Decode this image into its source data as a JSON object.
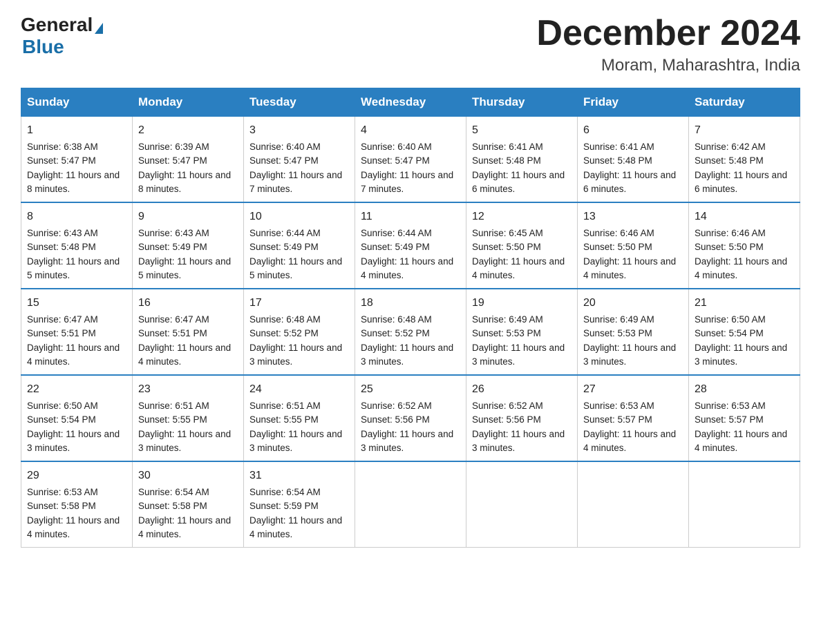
{
  "header": {
    "month_title": "December 2024",
    "location": "Moram, Maharashtra, India",
    "logo_general": "General",
    "logo_blue": "Blue"
  },
  "weekdays": [
    "Sunday",
    "Monday",
    "Tuesday",
    "Wednesday",
    "Thursday",
    "Friday",
    "Saturday"
  ],
  "weeks": [
    [
      {
        "day": "1",
        "sunrise": "6:38 AM",
        "sunset": "5:47 PM",
        "daylight": "11 hours and 8 minutes."
      },
      {
        "day": "2",
        "sunrise": "6:39 AM",
        "sunset": "5:47 PM",
        "daylight": "11 hours and 8 minutes."
      },
      {
        "day": "3",
        "sunrise": "6:40 AM",
        "sunset": "5:47 PM",
        "daylight": "11 hours and 7 minutes."
      },
      {
        "day": "4",
        "sunrise": "6:40 AM",
        "sunset": "5:47 PM",
        "daylight": "11 hours and 7 minutes."
      },
      {
        "day": "5",
        "sunrise": "6:41 AM",
        "sunset": "5:48 PM",
        "daylight": "11 hours and 6 minutes."
      },
      {
        "day": "6",
        "sunrise": "6:41 AM",
        "sunset": "5:48 PM",
        "daylight": "11 hours and 6 minutes."
      },
      {
        "day": "7",
        "sunrise": "6:42 AM",
        "sunset": "5:48 PM",
        "daylight": "11 hours and 6 minutes."
      }
    ],
    [
      {
        "day": "8",
        "sunrise": "6:43 AM",
        "sunset": "5:48 PM",
        "daylight": "11 hours and 5 minutes."
      },
      {
        "day": "9",
        "sunrise": "6:43 AM",
        "sunset": "5:49 PM",
        "daylight": "11 hours and 5 minutes."
      },
      {
        "day": "10",
        "sunrise": "6:44 AM",
        "sunset": "5:49 PM",
        "daylight": "11 hours and 5 minutes."
      },
      {
        "day": "11",
        "sunrise": "6:44 AM",
        "sunset": "5:49 PM",
        "daylight": "11 hours and 4 minutes."
      },
      {
        "day": "12",
        "sunrise": "6:45 AM",
        "sunset": "5:50 PM",
        "daylight": "11 hours and 4 minutes."
      },
      {
        "day": "13",
        "sunrise": "6:46 AM",
        "sunset": "5:50 PM",
        "daylight": "11 hours and 4 minutes."
      },
      {
        "day": "14",
        "sunrise": "6:46 AM",
        "sunset": "5:50 PM",
        "daylight": "11 hours and 4 minutes."
      }
    ],
    [
      {
        "day": "15",
        "sunrise": "6:47 AM",
        "sunset": "5:51 PM",
        "daylight": "11 hours and 4 minutes."
      },
      {
        "day": "16",
        "sunrise": "6:47 AM",
        "sunset": "5:51 PM",
        "daylight": "11 hours and 4 minutes."
      },
      {
        "day": "17",
        "sunrise": "6:48 AM",
        "sunset": "5:52 PM",
        "daylight": "11 hours and 3 minutes."
      },
      {
        "day": "18",
        "sunrise": "6:48 AM",
        "sunset": "5:52 PM",
        "daylight": "11 hours and 3 minutes."
      },
      {
        "day": "19",
        "sunrise": "6:49 AM",
        "sunset": "5:53 PM",
        "daylight": "11 hours and 3 minutes."
      },
      {
        "day": "20",
        "sunrise": "6:49 AM",
        "sunset": "5:53 PM",
        "daylight": "11 hours and 3 minutes."
      },
      {
        "day": "21",
        "sunrise": "6:50 AM",
        "sunset": "5:54 PM",
        "daylight": "11 hours and 3 minutes."
      }
    ],
    [
      {
        "day": "22",
        "sunrise": "6:50 AM",
        "sunset": "5:54 PM",
        "daylight": "11 hours and 3 minutes."
      },
      {
        "day": "23",
        "sunrise": "6:51 AM",
        "sunset": "5:55 PM",
        "daylight": "11 hours and 3 minutes."
      },
      {
        "day": "24",
        "sunrise": "6:51 AM",
        "sunset": "5:55 PM",
        "daylight": "11 hours and 3 minutes."
      },
      {
        "day": "25",
        "sunrise": "6:52 AM",
        "sunset": "5:56 PM",
        "daylight": "11 hours and 3 minutes."
      },
      {
        "day": "26",
        "sunrise": "6:52 AM",
        "sunset": "5:56 PM",
        "daylight": "11 hours and 3 minutes."
      },
      {
        "day": "27",
        "sunrise": "6:53 AM",
        "sunset": "5:57 PM",
        "daylight": "11 hours and 4 minutes."
      },
      {
        "day": "28",
        "sunrise": "6:53 AM",
        "sunset": "5:57 PM",
        "daylight": "11 hours and 4 minutes."
      }
    ],
    [
      {
        "day": "29",
        "sunrise": "6:53 AM",
        "sunset": "5:58 PM",
        "daylight": "11 hours and 4 minutes."
      },
      {
        "day": "30",
        "sunrise": "6:54 AM",
        "sunset": "5:58 PM",
        "daylight": "11 hours and 4 minutes."
      },
      {
        "day": "31",
        "sunrise": "6:54 AM",
        "sunset": "5:59 PM",
        "daylight": "11 hours and 4 minutes."
      },
      null,
      null,
      null,
      null
    ]
  ],
  "labels": {
    "sunrise": "Sunrise:",
    "sunset": "Sunset:",
    "daylight": "Daylight:"
  }
}
